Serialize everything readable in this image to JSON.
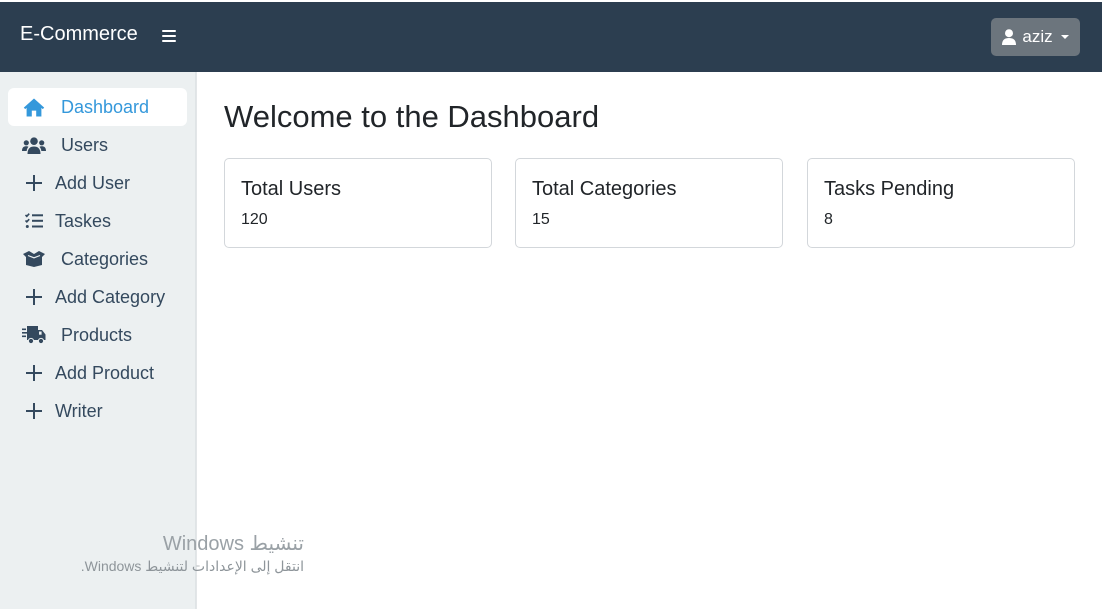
{
  "header": {
    "brand": "E-Commerce",
    "user": "aziz",
    "icons": {
      "menu": "hamburger-icon",
      "user": "user-icon",
      "dropdown": "caret-down-icon"
    }
  },
  "sidebar": {
    "items": [
      {
        "label": "Dashboard",
        "icon": "home-icon",
        "active": true
      },
      {
        "label": "Users",
        "icon": "users-icon"
      },
      {
        "label": "Add User",
        "icon": "plus-icon"
      },
      {
        "label": "Taskes",
        "icon": "task-list-icon"
      },
      {
        "label": "Categories",
        "icon": "box-open-icon"
      },
      {
        "label": "Add Category",
        "icon": "plus-icon"
      },
      {
        "label": "Products",
        "icon": "truck-icon"
      },
      {
        "label": "Add Product",
        "icon": "plus-icon"
      },
      {
        "label": "Writer",
        "icon": "plus-icon"
      }
    ]
  },
  "main": {
    "title": "Welcome to the Dashboard",
    "cards": [
      {
        "title": "Total Users",
        "value": "120"
      },
      {
        "title": "Total Categories",
        "value": "15"
      },
      {
        "title": "Tasks Pending",
        "value": "8"
      }
    ]
  },
  "watermark": {
    "line1": "تنشيط Windows",
    "line2": "انتقل إلى الإعدادات لتنشيط Windows."
  },
  "colors": {
    "topbar": "#2c3e50",
    "sidebar": "#ecf0f1",
    "accent": "#3498db",
    "user_button": "#6c757d"
  }
}
